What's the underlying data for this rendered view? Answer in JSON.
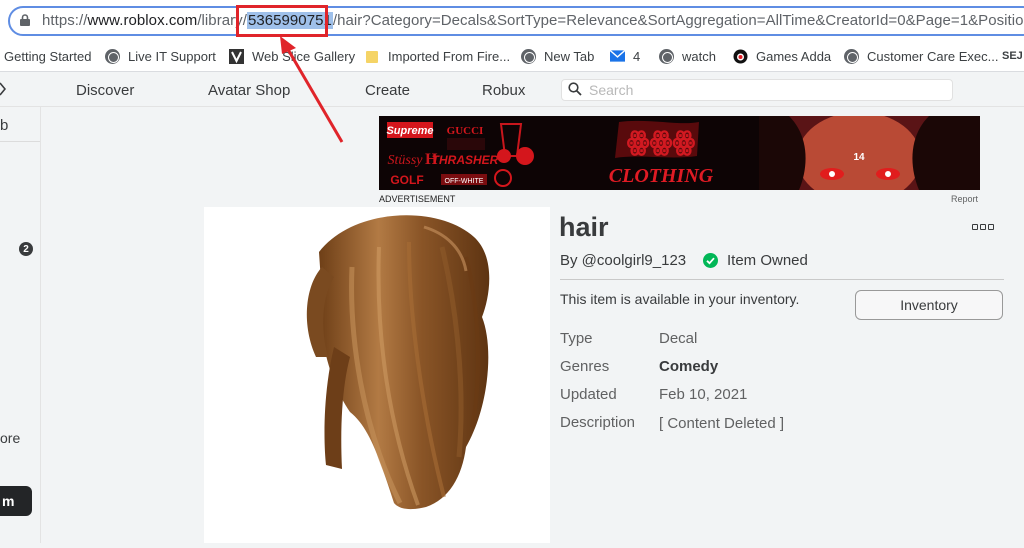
{
  "browser": {
    "url_prefix": "https://",
    "url_host": "www.roblox.com",
    "url_path_before": "/library/",
    "url_selected": "5365990751",
    "url_path_after": "/hair?Category=Decals&SortType=Relevance&SortAggregation=AllTime&CreatorId=0&Page=1&Position=1&",
    "bookmarks": [
      {
        "label": "Getting Started",
        "icon": "bookmark-icon"
      },
      {
        "label": "Live IT Support",
        "icon": "globe-icon"
      },
      {
        "label": "Web Slice Gallery",
        "icon": "web-slice-icon"
      },
      {
        "label": "Imported From Fire...",
        "icon": "folder-icon"
      },
      {
        "label": "New Tab",
        "icon": "globe-icon"
      },
      {
        "label": "4",
        "icon": "mail-icon"
      },
      {
        "label": "watch",
        "icon": "globe-icon"
      },
      {
        "label": "Games Adda",
        "icon": "games-adda-icon"
      },
      {
        "label": "Customer Care Exec...",
        "icon": "globe-icon"
      },
      {
        "label": "SEJ",
        "icon": "sej-icon"
      }
    ]
  },
  "nav": {
    "items": [
      "Discover",
      "Avatar Shop",
      "Create",
      "Robux"
    ],
    "search_placeholder": "Search"
  },
  "sidebar": {
    "partial_top": "b",
    "badge_count": "2",
    "partial_more": "ore",
    "partial_button": "m"
  },
  "ad": {
    "label": "ADVERTISEMENT",
    "report": "Report",
    "banner_words": [
      "Supreme",
      "GUCCI",
      "THRASHER",
      "GOLF",
      "OFF-WHITE",
      "CLOTHING",
      "14"
    ]
  },
  "item": {
    "title": "hair",
    "creator": "By @coolgirl9_123",
    "owned_text": "Item Owned",
    "inventory_message": "This item is available in your inventory.",
    "inventory_button": "Inventory",
    "fields": [
      {
        "label": "Type",
        "value": "Decal"
      },
      {
        "label": "Genres",
        "value": "Comedy"
      },
      {
        "label": "Updated",
        "value": "Feb 10, 2021"
      },
      {
        "label": "Description",
        "value": "[ Content Deleted ]"
      }
    ]
  },
  "colors": {
    "accent_blue": "#5f8de3",
    "annotation_red": "#e0242a",
    "owned_green": "#02b757",
    "hair_brown": "#8a5527"
  }
}
